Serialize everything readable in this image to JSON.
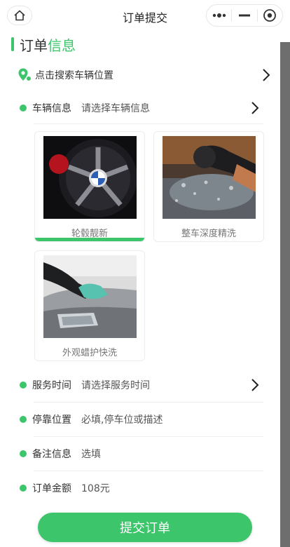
{
  "header": {
    "title": "订单提交"
  },
  "section": {
    "title_prefix": "订单",
    "title_highlight": "信息"
  },
  "location_row": {
    "label": "点击搜索车辆位置"
  },
  "vehicle_row": {
    "label": "车辆信息",
    "value": "请选择车辆信息"
  },
  "services": [
    {
      "label": "轮毂靓新",
      "selected": true
    },
    {
      "label": "整车深度精洗",
      "selected": false
    },
    {
      "label": "外观蜡护快洗",
      "selected": false
    }
  ],
  "time_row": {
    "label": "服务时间",
    "value": "请选择服务时间"
  },
  "parking_row": {
    "label": "停靠位置",
    "placeholder": "必填,停车位或描述"
  },
  "note_row": {
    "label": "备注信息",
    "placeholder": "选填"
  },
  "amount_row": {
    "label": "订单金额",
    "value": "108元"
  },
  "submit": {
    "label": "提交订单"
  },
  "colors": {
    "accent": "#3cc56a"
  },
  "icons": [
    "home-icon",
    "more-icon",
    "minimize-icon",
    "close-icon",
    "location-icon",
    "chevron-right-icon"
  ]
}
